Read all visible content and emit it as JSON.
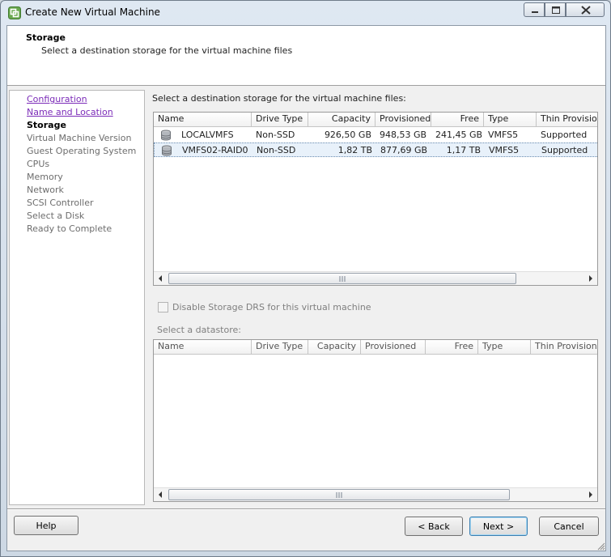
{
  "window": {
    "title": "Create New Virtual Machine",
    "icon": "vmware-logo-icon",
    "controls": [
      "minimize-icon",
      "maximize-icon",
      "close-icon"
    ]
  },
  "header": {
    "title": "Storage",
    "subtitle": "Select a destination storage for the virtual machine files"
  },
  "steps": [
    {
      "label": "Configuration",
      "state": "link"
    },
    {
      "label": "Name and Location",
      "state": "link"
    },
    {
      "label": "Storage",
      "state": "current"
    },
    {
      "label": "Virtual Machine Version",
      "state": "pending"
    },
    {
      "label": "Guest Operating System",
      "state": "pending"
    },
    {
      "label": "CPUs",
      "state": "pending"
    },
    {
      "label": "Memory",
      "state": "pending"
    },
    {
      "label": "Network",
      "state": "pending"
    },
    {
      "label": "SCSI Controller",
      "state": "pending"
    },
    {
      "label": "Select a Disk",
      "state": "pending"
    },
    {
      "label": "Ready to Complete",
      "state": "pending"
    }
  ],
  "storage_table": {
    "caption": "Select a destination storage for the virtual machine files:",
    "columns": [
      "Name",
      "Drive Type",
      "Capacity",
      "Provisioned",
      "Free",
      "Type",
      "Thin Provisio"
    ],
    "rows": [
      {
        "name": "LOCALVMFS",
        "drive_type": "Non-SSD",
        "capacity": "926,50 GB",
        "provisioned": "948,53 GB",
        "free": "241,45 GB",
        "type": "VMFS5",
        "thin": "Supported",
        "selected": false
      },
      {
        "name": "VMFS02-RAID0",
        "drive_type": "Non-SSD",
        "capacity": "1,82 TB",
        "provisioned": "877,69 GB",
        "free": "1,17 TB",
        "type": "VMFS5",
        "thin": "Supported",
        "selected": true
      }
    ],
    "row_icon": "datastore-icon"
  },
  "drs_checkbox": {
    "label": "Disable Storage DRS for this virtual machine",
    "checked": false,
    "enabled": false
  },
  "datastore_table": {
    "caption": "Select a datastore:",
    "columns": [
      "Name",
      "Drive Type",
      "Capacity",
      "Provisioned",
      "Free",
      "Type",
      "Thin Provisionin"
    ]
  },
  "buttons": {
    "help": "Help",
    "back": "< Back",
    "next": "Next >",
    "cancel": "Cancel"
  },
  "colors": {
    "link": "#7b2bb8",
    "selected_row": "#e8f1fa",
    "accent_border": "#3c7fb1"
  }
}
